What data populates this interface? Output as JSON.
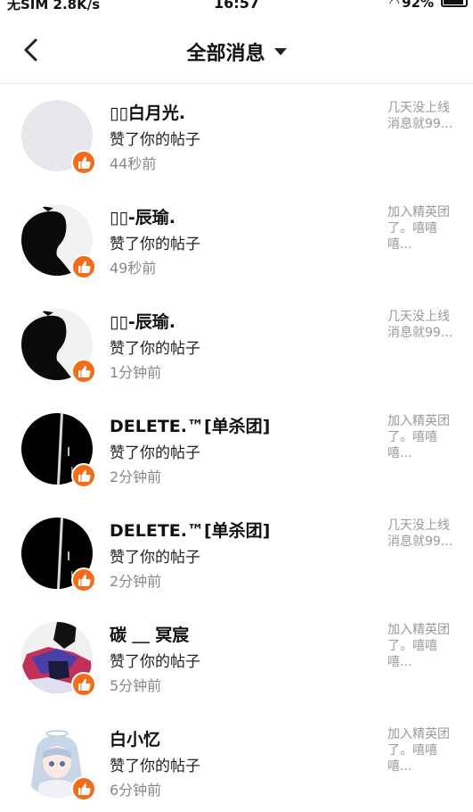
{
  "status_bar": {
    "carrier": "无SIM 2.8K/s",
    "time": "16:57",
    "battery": "92%"
  },
  "header": {
    "title": "全部消息",
    "back_icon": "back-arrow-icon",
    "dropdown_icon": "caret-down-icon"
  },
  "colors": {
    "like_badge": "#f26c1a",
    "divider": "#e6e6e6",
    "muted_text": "#888888"
  },
  "notifications": [
    {
      "username": "▯▯白月光.",
      "action": "赞了你的帖子",
      "time": "44秒前",
      "preview": [
        "几天没上线",
        "消息就99..."
      ],
      "avatar": "blank"
    },
    {
      "username": "▯▯-辰瑜.",
      "action": "赞了你的帖子",
      "time": "49秒前",
      "preview": [
        "加入精英团",
        "了。嘻嘻",
        "嘻..."
      ],
      "avatar": "silhouette"
    },
    {
      "username": "▯▯-辰瑜.",
      "action": "赞了你的帖子",
      "time": "1分钟前",
      "preview": [
        "几天没上线",
        "消息就99..."
      ],
      "avatar": "silhouette"
    },
    {
      "username": "DELETE.™[单杀团]",
      "action": "赞了你的帖子",
      "time": "2分钟前",
      "preview": [
        "加入精英团",
        "了。嘻嘻",
        "嘻..."
      ],
      "avatar": "dark"
    },
    {
      "username": "DELETE.™[单杀团]",
      "action": "赞了你的帖子",
      "time": "2分钟前",
      "preview": [
        "几天没上线",
        "消息就99..."
      ],
      "avatar": "dark"
    },
    {
      "username": "碳 ＿ 冥宸",
      "action": "赞了你的帖子",
      "time": "5分钟前",
      "preview": [
        "加入精英团",
        "了。嘻嘻",
        "嘻..."
      ],
      "avatar": "colorful"
    },
    {
      "username": "白小忆",
      "action": "赞了你的帖子",
      "time": "6分钟前",
      "preview": [
        "加入精英团",
        "了。嘻嘻",
        "嘻..."
      ],
      "avatar": "anime"
    }
  ]
}
